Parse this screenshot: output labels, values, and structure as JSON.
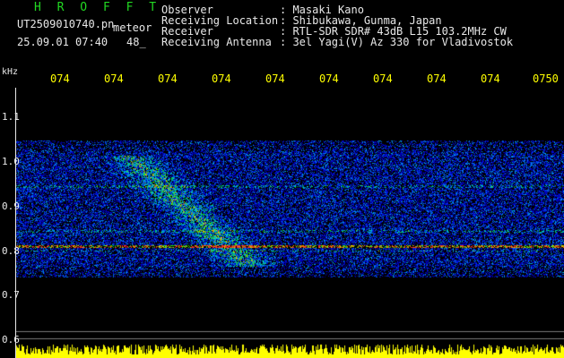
{
  "header": {
    "app_title": "H R O F F T",
    "filename": "UT2509010740.pn",
    "meteor_tag": "meteor",
    "datetime": "25.09.01 07:40",
    "frame_no": "48_"
  },
  "info": [
    {
      "label": "Observer",
      "value": ": Masaki Kano"
    },
    {
      "label": "Receiving Location",
      "value": ": Shibukawa, Gunma, Japan"
    },
    {
      "label": "Receiver",
      "value": ": RTL-SDR SDR# 43dB L15 103.2MHz CW"
    },
    {
      "label": "Receiving Antenna",
      "value": ": 3el Yagi(V) Az 330 for Vladivostok"
    }
  ],
  "axis": {
    "unit": "kHz",
    "time_ticks": [
      "074",
      "074",
      "074",
      "074",
      "074",
      "074",
      "074",
      "074",
      "074",
      "0750"
    ],
    "freq_ticks": [
      "1.1",
      "1.0",
      "0.9",
      "0.8",
      "0.7",
      "0.6"
    ]
  },
  "colors": {
    "background": "#000000",
    "title": "#22d822",
    "tick": "#ffff00",
    "text": "#e8e8e8",
    "noise_floor": "#ffff00"
  }
}
